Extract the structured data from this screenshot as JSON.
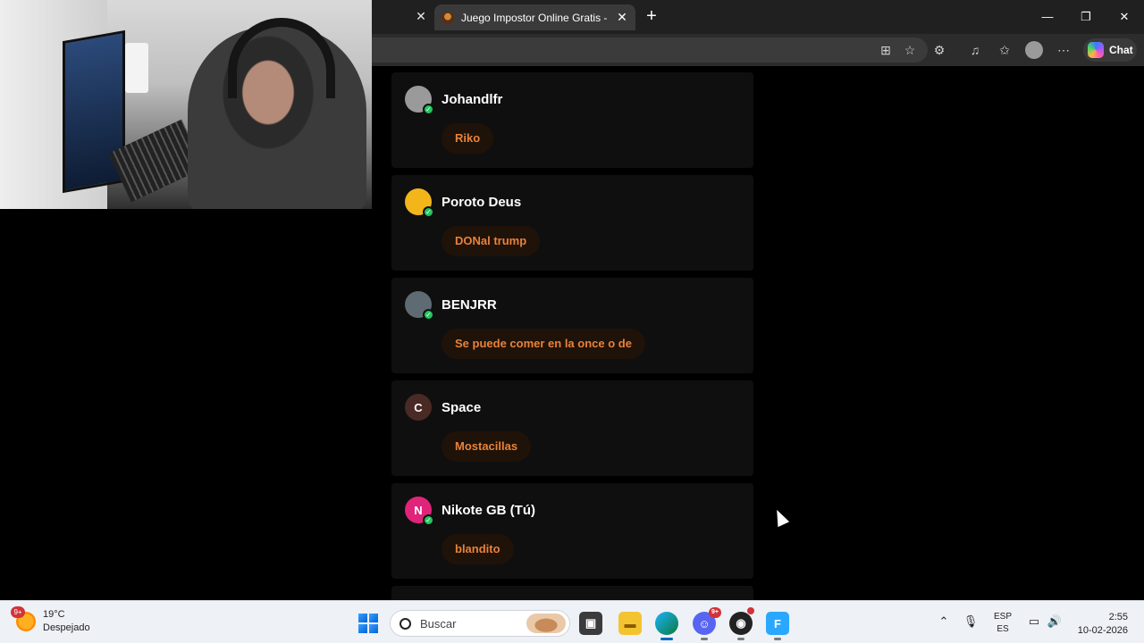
{
  "browser": {
    "active_tab_title": "Juego Impostor Online Gratis - Juego",
    "chat_label": "Chat",
    "icons": [
      "close-icon",
      "new-tab-icon",
      "minimize-icon",
      "restore-icon",
      "window-close-icon",
      "extensions-icon",
      "favorite-star-icon",
      "puzzle-icon",
      "media-icon",
      "favorites-icon",
      "profile-icon",
      "more-icon",
      "copilot-icon"
    ]
  },
  "players": [
    {
      "name": "Johandlfr",
      "word": "Riko",
      "avatar_letter": "",
      "avatar_color": "#9a9a9a"
    },
    {
      "name": "Poroto Deus",
      "word": "DONal trump",
      "avatar_letter": "",
      "avatar_color": "#f2b61b"
    },
    {
      "name": "BENJRR",
      "word": "Se puede comer en la once o de",
      "avatar_letter": "",
      "avatar_color": "#5f6b72"
    },
    {
      "name": "Space",
      "word": "Mostacillas",
      "avatar_letter": "C",
      "avatar_color": "#4a2a24"
    },
    {
      "name": "Nikote GB (Tú)",
      "word": "blandito",
      "avatar_letter": "N",
      "avatar_color": "#e0247a"
    }
  ],
  "taskbar": {
    "weather_badge": "9+",
    "temperature": "19°C",
    "condition": "Despejado",
    "search_label": "Buscar",
    "discord_badge": "9+",
    "lang_top": "ESP",
    "lang_bottom": "ES",
    "time": "2:55",
    "date": "10-02-2026",
    "app_f_letter": "F"
  }
}
